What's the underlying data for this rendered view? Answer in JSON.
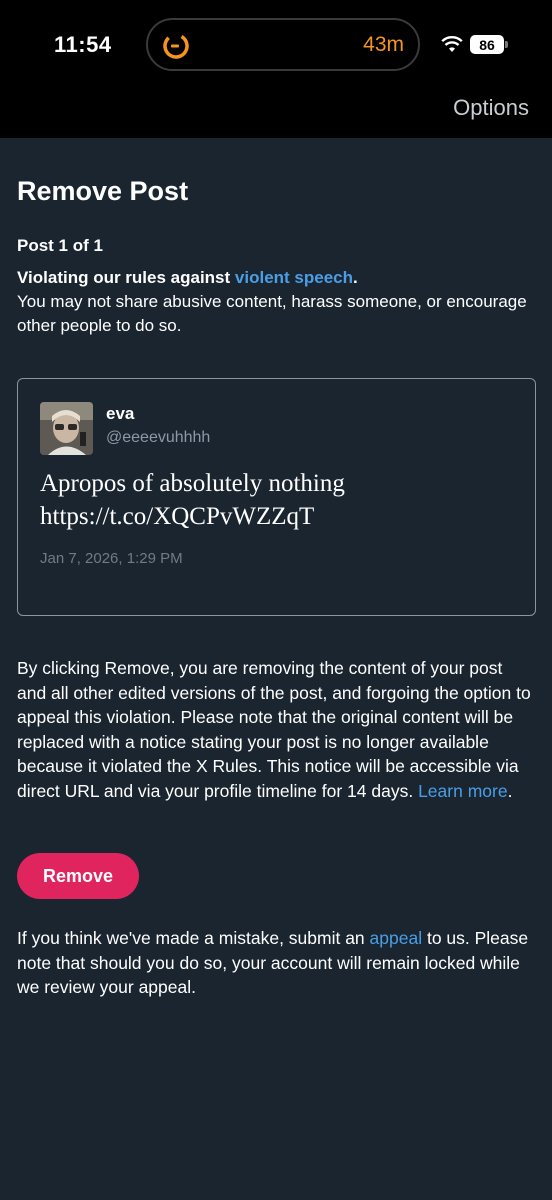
{
  "status_bar": {
    "time": "11:54",
    "island_text": "43m",
    "battery": "86",
    "island_color": "#f7941d"
  },
  "nav": {
    "options_label": "Options"
  },
  "page": {
    "title": "Remove Post",
    "post_count": "Post 1 of 1",
    "rule_prefix": "Violating our rules against ",
    "rule_link": "violent speech",
    "rule_suffix": ".",
    "rule_description": "You may not share abusive content, harass someone, or encourage other people to do so."
  },
  "tweet": {
    "author_name": "eva",
    "author_handle": "@eeeevuhhhh",
    "text_line1": "Apropos of absolutely nothing",
    "text_line2": "https://t.co/XQCPvWZZqT",
    "date": "Jan 7, 2026, 1:29 PM"
  },
  "explanation": {
    "text": "By clicking Remove, you are removing the content of your post and all other edited versions of the post, and forgoing the option to appeal this violation. Please note that the original content will be replaced with a notice stating your post is no longer available because it violated the X Rules. This notice will be accessible via direct URL and via your profile timeline for 14 days. ",
    "learn_more": "Learn more",
    "end": "."
  },
  "remove_button": {
    "label": "Remove",
    "color": "#e0245e"
  },
  "appeal": {
    "prefix": "If you think we've made a mistake, submit an ",
    "link": "appeal",
    "suffix": " to us. Please note that should you do so, your account will remain locked while we review your appeal."
  },
  "colors": {
    "background": "#1b2530",
    "link": "#4a9ee6"
  }
}
